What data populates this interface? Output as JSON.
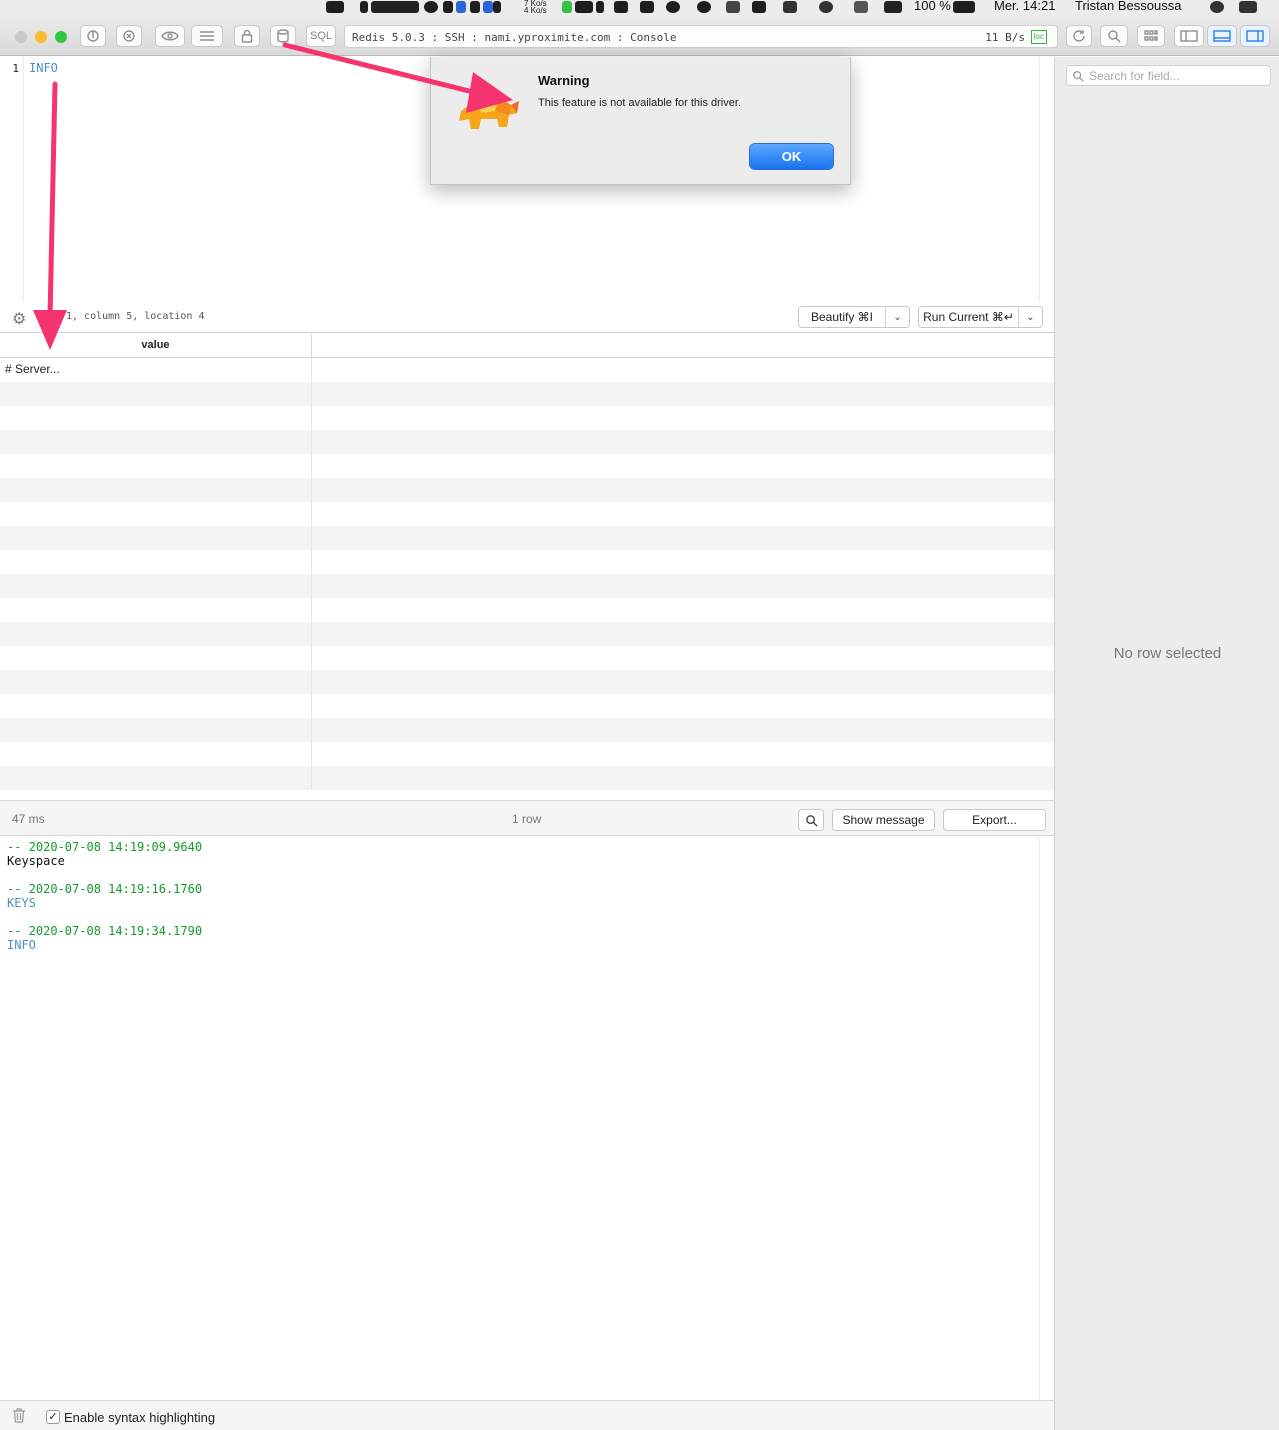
{
  "menubar": {
    "net_up": "7 Ko/s",
    "net_down": "4 Ko/s",
    "battery": "100 %",
    "clock": "Mer. 14:21",
    "user": "Tristan Bessoussa"
  },
  "toolbar": {
    "sql_label": "SQL",
    "connection": "Redis 5.0.3 : SSH : nami.yproximite.com : Console",
    "speed": "11 B/s",
    "loc_badge": "loc"
  },
  "editor": {
    "line_number": "1",
    "query": "INFO",
    "cursor_position": "1, column 5, location 4",
    "beautify_label": "Beautify ⌘I",
    "run_label": "Run Current ⌘↵"
  },
  "grid": {
    "column_header": "value",
    "rows": [
      "# Server..."
    ]
  },
  "results": {
    "duration": "47 ms",
    "row_count": "1 row",
    "show_message_label": "Show message",
    "export_label": "Export..."
  },
  "log": [
    {
      "timestamp": "-- 2020-07-08 14:19:09.9640",
      "command": "Keyspace",
      "style": "plain"
    },
    {
      "timestamp": "-- 2020-07-08 14:19:16.1760",
      "command": "KEYS",
      "style": "kw"
    },
    {
      "timestamp": "-- 2020-07-08 14:19:34.1790",
      "command": "INFO",
      "style": "kw"
    }
  ],
  "bottom": {
    "syntax_label": "Enable syntax highlighting",
    "syntax_checked": true
  },
  "sidebar": {
    "search_placeholder": "Search for field...",
    "empty_label": "No row selected"
  },
  "dialog": {
    "title": "Warning",
    "message": "This feature is not available for this driver.",
    "ok_label": "OK"
  },
  "colors": {
    "accent": "#1a72f0",
    "annotation_arrow": "#f5346f",
    "timestamp": "#159a2c",
    "keyword": "#4a90c8"
  }
}
